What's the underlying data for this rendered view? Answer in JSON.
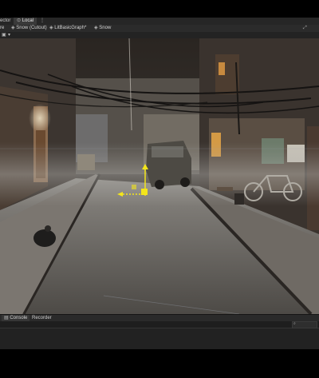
{
  "top_tabs": {
    "inspector_label": "ector",
    "local_label": "Local",
    "local_icon": "local-lock-icon",
    "menu_icon": "panel-menu-icon"
  },
  "doc_tabs": [
    {
      "label": "re",
      "icon": "scene-icon"
    },
    {
      "label": "Snow (Cutout)",
      "icon": "shadergraph-icon"
    },
    {
      "label": "LitBasicGraph*",
      "icon": "shadergraph-icon"
    },
    {
      "label": "Snow",
      "icon": "shadergraph-icon"
    }
  ],
  "toolbar": {
    "dropdown_icon": "camera-dropdown-icon",
    "gizmo_icon": "gizmo-toggle-icon"
  },
  "bottom_tabs": [
    {
      "label": "Console",
      "icon": "console-icon"
    },
    {
      "label": "Recorder",
      "icon": ""
    }
  ],
  "console": {
    "search_icon": "console-search-icon"
  },
  "colors": {
    "gizmo_yellow": "#f3e51b",
    "panel_dark": "#262626",
    "tab_active": "#3a3a3a"
  }
}
